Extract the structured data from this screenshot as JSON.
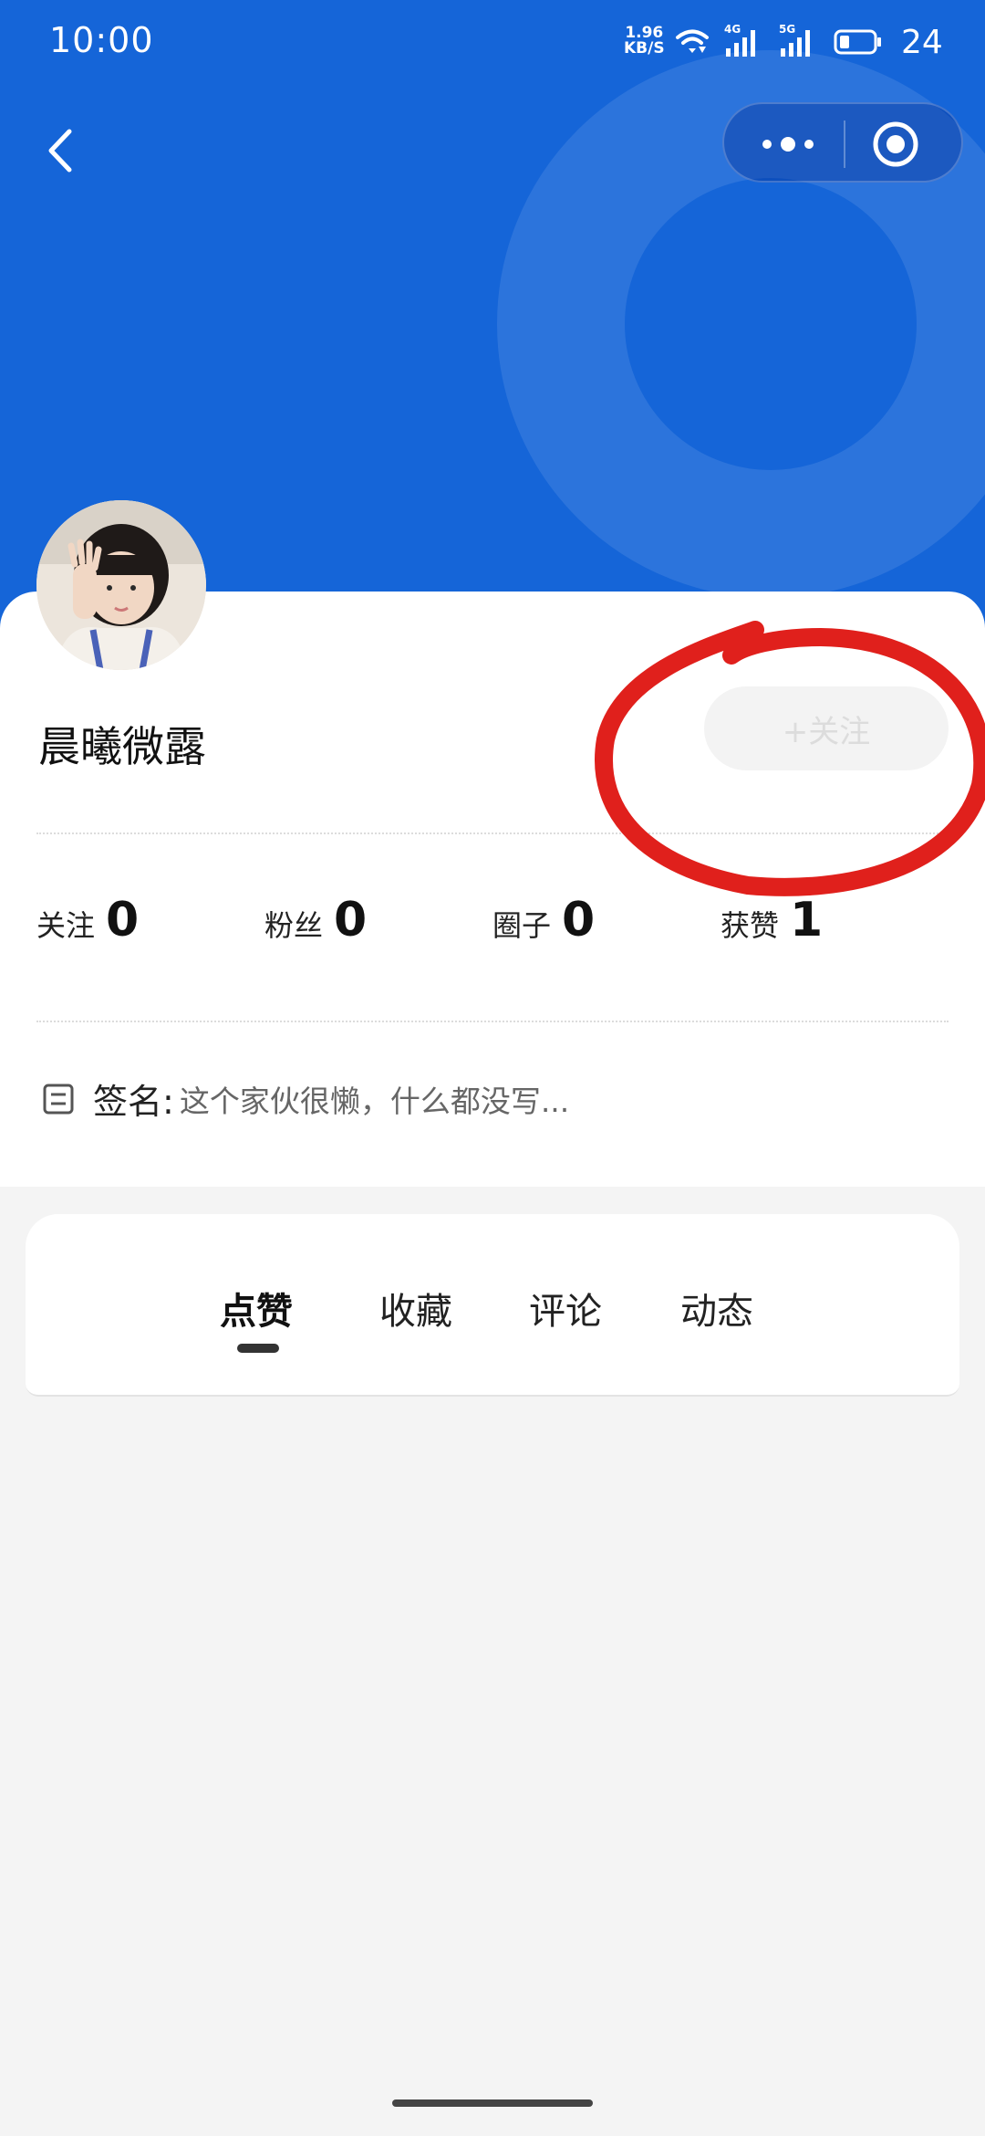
{
  "status_bar": {
    "time": "10:00",
    "net_speed_value": "1.96",
    "net_speed_unit": "KB/S",
    "sim1_label": "4G",
    "sim2_label": "5G",
    "battery": "24"
  },
  "header": {
    "background_color": "#1565d8",
    "back_icon": "chevron-left-icon",
    "capsule_more_icon": "more-dots-icon",
    "capsule_close_icon": "target-circle-icon"
  },
  "profile": {
    "nickname": "晨曦微露",
    "follow_button": "+关注",
    "stats": [
      {
        "label": "关注",
        "value": "0"
      },
      {
        "label": "粉丝",
        "value": "0"
      },
      {
        "label": "圈子",
        "value": "0"
      },
      {
        "label": "获赞",
        "value": "1"
      }
    ],
    "signature_label": "签名:",
    "signature_text": "这个家伙很懒，什么都没写..."
  },
  "tabs": [
    {
      "label": "点赞",
      "active": true
    },
    {
      "label": "收藏",
      "active": false
    },
    {
      "label": "评论",
      "active": false
    },
    {
      "label": "动态",
      "active": false
    }
  ],
  "annotation_color": "#e0201c"
}
